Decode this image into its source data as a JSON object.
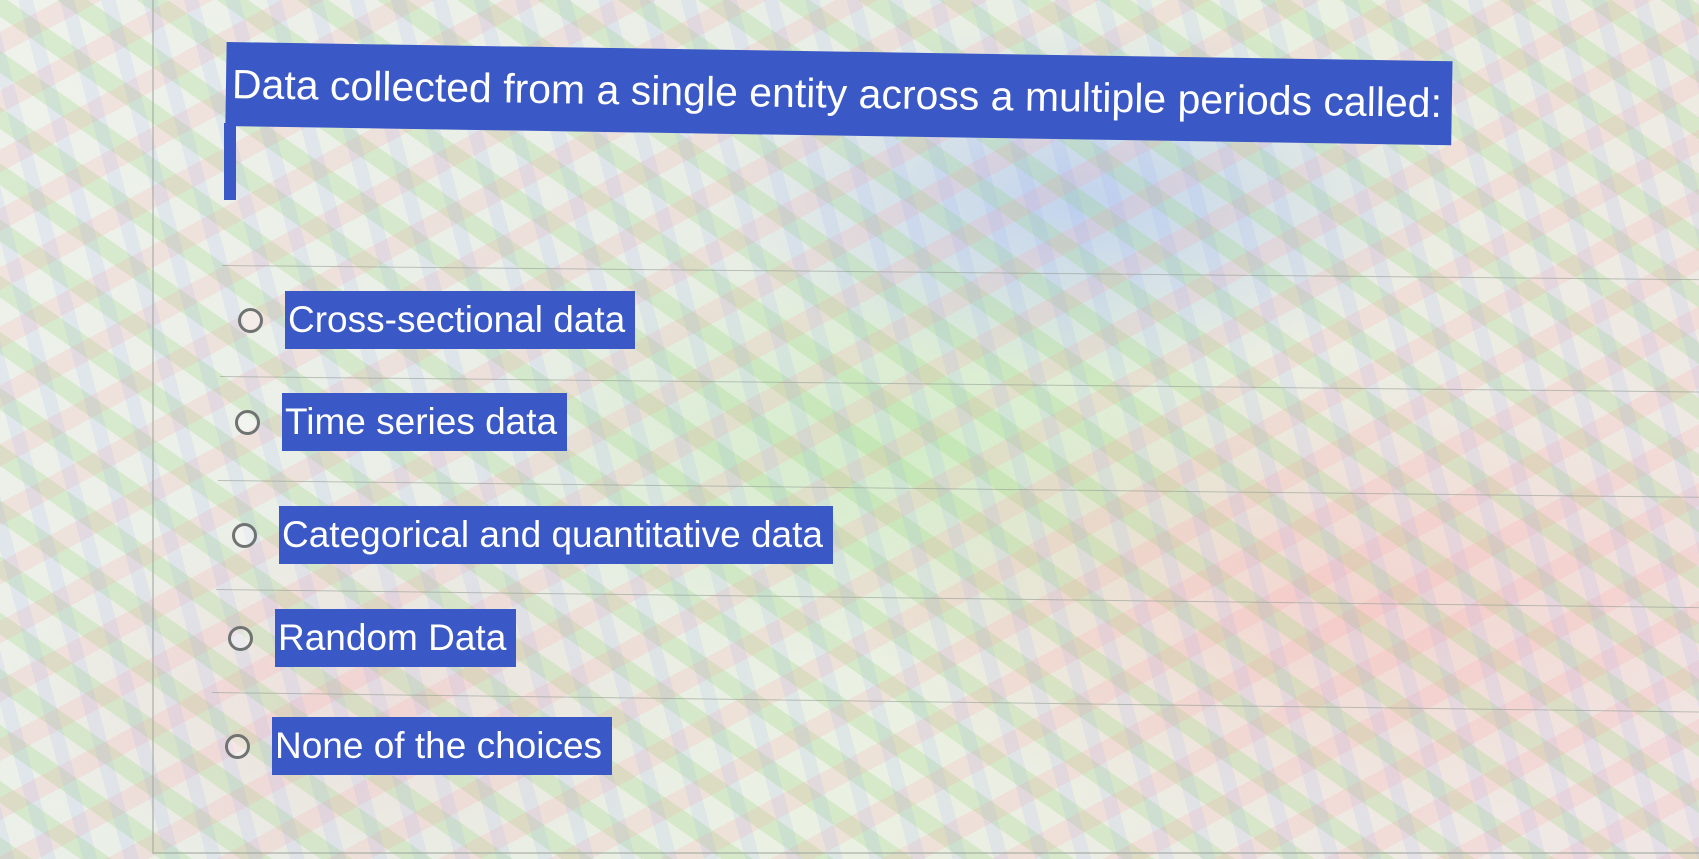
{
  "question": {
    "text": "Data collected from a single entity across a multiple periods called:"
  },
  "options": [
    {
      "label": "Cross-sectional data"
    },
    {
      "label": "Time series data"
    },
    {
      "label": "Categorical and quantitative data"
    },
    {
      "label": "Random Data"
    },
    {
      "label": "None of the choices"
    }
  ],
  "colors": {
    "highlight": "#3a58c6",
    "text_on_highlight": "#ffffff",
    "radio_border": "#6f7372"
  },
  "icons": {
    "radio": "radio-unselected-icon"
  }
}
